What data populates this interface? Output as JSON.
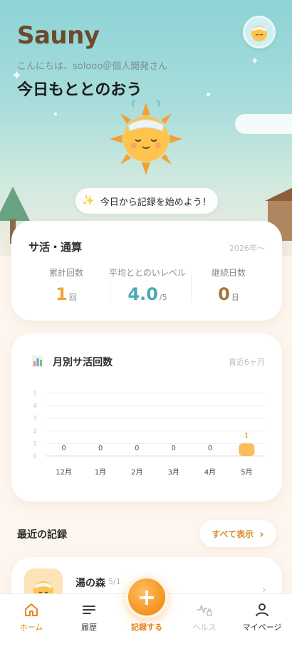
{
  "app": {
    "title": "Sauny"
  },
  "header": {
    "greeting": "こんにちは、solooo＠個人開発さん",
    "headline": "今日もととのおう",
    "start_button": "今日から記録を始めよう！",
    "start_icon": "sparkles-icon"
  },
  "stats": {
    "title": "サ活・通算",
    "since": "2026年〜",
    "items": [
      {
        "label": "累計回数",
        "value": "1",
        "unit": "回",
        "color": "#f0a23a"
      },
      {
        "label": "平均ととのいレベル",
        "value": "4.0",
        "unit": "/5",
        "color": "#4aa9b0"
      },
      {
        "label": "継続日数",
        "value": "0",
        "unit": "日",
        "color": "#a5763f"
      }
    ]
  },
  "monthly": {
    "title": "月別サ活回数",
    "range": "直近6ヶ月"
  },
  "chart_data": {
    "type": "bar",
    "categories": [
      "12月",
      "1月",
      "2月",
      "3月",
      "4月",
      "5月"
    ],
    "values": [
      0,
      0,
      0,
      0,
      0,
      1
    ],
    "data_labels": [
      "0",
      "0",
      "0",
      "0",
      "0",
      "1"
    ],
    "ylim": [
      0,
      5
    ],
    "yticks": [
      "0",
      "1",
      "2",
      "3",
      "4",
      "5"
    ],
    "bar_color": "#fbbd5b",
    "grid": true
  },
  "recent": {
    "title": "最近の記録",
    "see_all": "すべて表示",
    "items": [
      {
        "name": "湯の森",
        "date": "5/1"
      }
    ]
  },
  "tabbar": {
    "items": [
      {
        "label": "ホーム",
        "icon": "home-icon",
        "active": true
      },
      {
        "label": "履歴",
        "icon": "list-icon",
        "active": false
      },
      {
        "label": "記録する",
        "icon": "plus-icon",
        "active": false
      },
      {
        "label": "ヘルス",
        "icon": "health-lock-icon",
        "active": false
      },
      {
        "label": "マイページ",
        "icon": "user-icon",
        "active": false
      }
    ],
    "active_color": "#e2861f",
    "inactive_color": "#3a3a3a",
    "disabled_color": "#c0c0c0"
  }
}
